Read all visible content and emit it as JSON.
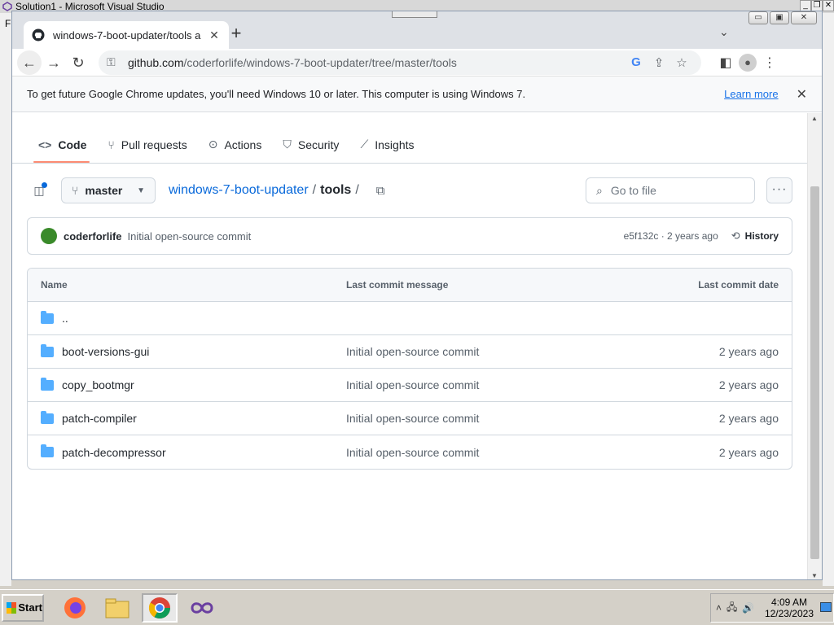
{
  "vs": {
    "title": "Solution1 - Microsoft Visual Studio",
    "side_letter": "F"
  },
  "browser": {
    "tab_title": "windows-7-boot-updater/tools a",
    "url_host": "github.com",
    "url_path": "/coderforlife/windows-7-boot-updater/tree/master/tools",
    "infobar_message": "To get future Google Chrome updates, you'll need Windows 10 or later. This computer is using Windows 7.",
    "infobar_link": "Learn more"
  },
  "repo_nav": {
    "tabs": [
      {
        "label": "Code",
        "icon": "code-icon"
      },
      {
        "label": "Pull requests",
        "icon": "pull-request-icon"
      },
      {
        "label": "Actions",
        "icon": "play-icon"
      },
      {
        "label": "Security",
        "icon": "shield-icon"
      },
      {
        "label": "Insights",
        "icon": "graph-icon"
      }
    ]
  },
  "file_head": {
    "branch": "master",
    "repo_link": "windows-7-boot-updater",
    "current_dir": "tools",
    "goto_placeholder": "Go to file"
  },
  "commit": {
    "author": "coderforlife",
    "message": "Initial open-source commit",
    "meta": "e5f132c · 2 years ago",
    "history_label": "History"
  },
  "table": {
    "headers": [
      "Name",
      "Last commit message",
      "Last commit date"
    ],
    "parent": "..",
    "rows": [
      {
        "name": "boot-versions-gui",
        "message": "Initial open-source commit",
        "date": "2 years ago"
      },
      {
        "name": "copy_bootmgr",
        "message": "Initial open-source commit",
        "date": "2 years ago"
      },
      {
        "name": "patch-compiler",
        "message": "Initial open-source commit",
        "date": "2 years ago"
      },
      {
        "name": "patch-decompressor",
        "message": "Initial open-source commit",
        "date": "2 years ago"
      }
    ]
  },
  "taskbar": {
    "start_label": "Start",
    "time": "4:09 AM",
    "date": "12/23/2023"
  }
}
